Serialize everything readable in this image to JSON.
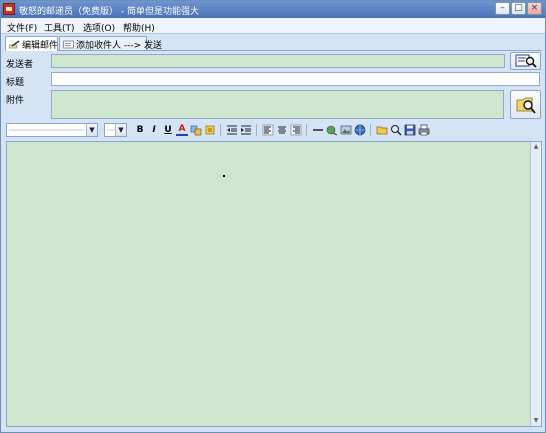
{
  "window": {
    "title": "敬怒的邮递员（免费版） - 简单但是功能强大",
    "controls": {
      "minimize": "–",
      "maximize": "□",
      "close": "×"
    }
  },
  "menu": [
    {
      "label": "文件(F)"
    },
    {
      "label": "工具(T)"
    },
    {
      "label": "选项(O)"
    },
    {
      "label": "帮助(H)"
    }
  ],
  "tabs": [
    {
      "label": "编辑邮件",
      "icon": "edit-icon",
      "active": true
    },
    {
      "label": "添加收件人 ---> 发送",
      "icon": "address-card-icon",
      "active": false
    }
  ],
  "form": {
    "sender_label": "发送者",
    "sender_value": "",
    "subject_label": "标题",
    "subject_value": "",
    "attachment_label": "附件",
    "attachment_value": ""
  },
  "toolbar": {
    "font_family_value": "",
    "font_size_value": "",
    "bold": "B",
    "italic": "I",
    "underline": "U",
    "font_color": "A",
    "icons": [
      "bold-icon",
      "italic-icon",
      "underline-icon",
      "font-color-icon",
      "highlight-icon",
      "format-icon",
      "outdent-icon",
      "indent-icon",
      "align-left-icon",
      "align-center-icon",
      "align-right-icon",
      "horizontal-rule-icon",
      "insert-link-icon",
      "insert-image-icon",
      "world-icon",
      "open-folder-icon",
      "search-icon",
      "save-icon",
      "print-icon"
    ]
  },
  "editor": {
    "content": ""
  },
  "colors": {
    "window_bg": "#d4e4f5",
    "field_green": "#cde6cd",
    "border": "#8aa6c9"
  }
}
